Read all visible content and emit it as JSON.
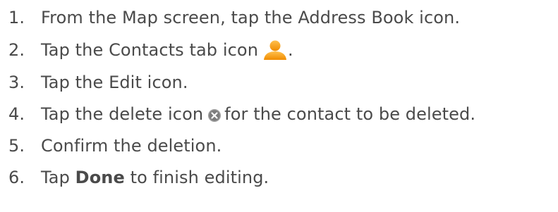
{
  "steps": [
    {
      "number": "1.",
      "text": "From the Map screen, tap the Address Book icon."
    },
    {
      "number": "2.",
      "text_before": "Tap the Contacts tab icon",
      "icon": "contacts-person-icon",
      "text_after": "."
    },
    {
      "number": "3.",
      "text": "Tap the Edit icon."
    },
    {
      "number": "4.",
      "text_before": "Tap the delete icon",
      "icon": "delete-circle-x-icon",
      "text_after": "for the contact to be deleted."
    },
    {
      "number": "5.",
      "text": "Confirm the deletion."
    },
    {
      "number": "6.",
      "text_before": "Tap",
      "bold": "Done",
      "text_after": "to finish editing."
    }
  ],
  "colors": {
    "text": "#4a4a4a",
    "contacts_icon": "#f5a623",
    "delete_icon": "#9b9b9b"
  }
}
